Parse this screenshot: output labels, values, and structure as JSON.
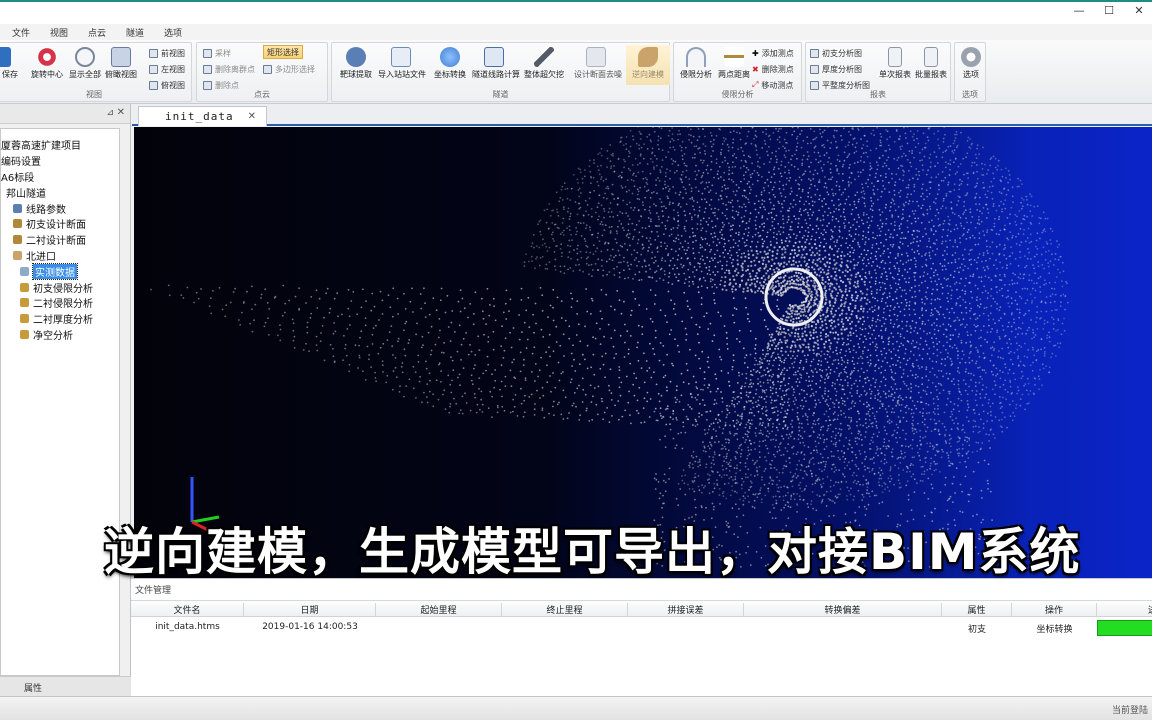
{
  "window": {
    "controls": [
      "—",
      "☐",
      "✕"
    ]
  },
  "menu": [
    "文件",
    "视图",
    "点云",
    "隧道",
    "选项"
  ],
  "ribbon": {
    "view_group": {
      "label": "视图",
      "big": [
        {
          "label": "保存",
          "icon": "save-icon",
          "color": "#2f6fc0"
        },
        {
          "label": "旋转中心",
          "icon": "rotate-center-icon",
          "color": "#d6334a"
        },
        {
          "label": "显示全部",
          "icon": "zoom-all-icon",
          "color": "#7a869a"
        },
        {
          "label": "俯瞰视图",
          "icon": "birdview-icon",
          "color": "#6a7aa0"
        }
      ],
      "small": [
        "前视图",
        "左视图",
        "俯视图"
      ]
    },
    "points_group": {
      "label": "点云",
      "items": [
        "采样",
        "删除离群点",
        "删除点",
        "矩形选择",
        "多边形选择"
      ]
    },
    "tunnel_group": {
      "label": "隧道",
      "big": [
        {
          "label": "靶球提取",
          "icon": "target-icon",
          "color": "#5a7fb5"
        },
        {
          "label": "导入站站文件",
          "icon": "import-icon",
          "color": "#6f8bb8"
        },
        {
          "label": "坐标转换",
          "icon": "coord-convert-icon",
          "color": "#3f7fd0"
        },
        {
          "label": "隧道线路计算",
          "icon": "route-calc-icon",
          "color": "#4a6fa8"
        },
        {
          "label": "整体超欠挖",
          "icon": "excavation-icon",
          "color": "#555b66"
        },
        {
          "label": "设计断面去噪",
          "icon": "denoise-icon",
          "color": "#aab3c0"
        },
        {
          "label": "逆向建模",
          "icon": "reverse-model-icon",
          "color": "#c9a36a"
        }
      ]
    },
    "limit_group": {
      "label": "侵限分析",
      "big": [
        {
          "label": "侵限分析",
          "icon": "intrusion-icon",
          "color": "#8fa0b8"
        },
        {
          "label": "两点距离",
          "icon": "distance-icon",
          "color": "#b08a3a"
        }
      ],
      "small": [
        "添加测点",
        "删除测点",
        "移动测点"
      ]
    },
    "report_group": {
      "label": "报表",
      "small": [
        "初支分析图",
        "厚度分析图",
        "平整度分析图"
      ],
      "big": [
        {
          "label": "单次报表",
          "icon": "report-icon",
          "color": "#8a96a8"
        },
        {
          "label": "批量报表",
          "icon": "batch-report-icon",
          "color": "#8a96a8"
        }
      ]
    },
    "options_group": {
      "label": "选项",
      "big": [
        {
          "label": "选项",
          "icon": "gear-icon",
          "color": "#9aa3ad"
        }
      ]
    }
  },
  "tree": [
    {
      "label": "厦蓉高速扩建项目",
      "indent": 0,
      "icon": "",
      "selected": false
    },
    {
      "label": "编码设置",
      "indent": 0,
      "icon": "",
      "selected": false
    },
    {
      "label": "A6标段",
      "indent": 0,
      "icon": "",
      "selected": false
    },
    {
      "label": "邦山隧道",
      "indent": 1,
      "icon": "",
      "selected": false
    },
    {
      "label": "线路参数",
      "indent": 2,
      "icon": "#5b7fb0",
      "selected": false
    },
    {
      "label": "初支设计断面",
      "indent": 2,
      "icon": "#b0883a",
      "selected": false
    },
    {
      "label": "二衬设计断面",
      "indent": 2,
      "icon": "#b0883a",
      "selected": false
    },
    {
      "label": "北进口",
      "indent": 2,
      "icon": "#c9a36a",
      "selected": false
    },
    {
      "label": "实测数据",
      "indent": 3,
      "icon": "#8fa9c8",
      "selected": true
    },
    {
      "label": "初支侵限分析",
      "indent": 3,
      "icon": "#c79a3c",
      "selected": false
    },
    {
      "label": "二衬侵限分析",
      "indent": 3,
      "icon": "#c79a3c",
      "selected": false
    },
    {
      "label": "二衬厚度分析",
      "indent": 3,
      "icon": "#c79a3c",
      "selected": false
    },
    {
      "label": "净空分析",
      "indent": 3,
      "icon": "#c79a3c",
      "selected": false
    }
  ],
  "left_footer": "属性",
  "doc_tab": "init_data",
  "subtitle": "逆向建模，生成模型可导出，对接BIM系统",
  "file_panel": {
    "title": "文件管理",
    "columns": [
      "文件名",
      "日期",
      "起始里程",
      "终止里程",
      "拼接误差",
      "转换偏差",
      "属性",
      "操作",
      "进"
    ],
    "rows": [
      {
        "name": "init_data.htms",
        "date": "2019-01-16 14:00:53",
        "start": "",
        "end": "",
        "splice": "",
        "offset": "",
        "attr": "初支",
        "action": "坐标转换",
        "progress": 1.0
      }
    ]
  },
  "status_right": "当前登陆",
  "colors": {
    "accent": "#2b5fa8",
    "progress": "#22dd22",
    "selection": "#3a8ee6"
  }
}
